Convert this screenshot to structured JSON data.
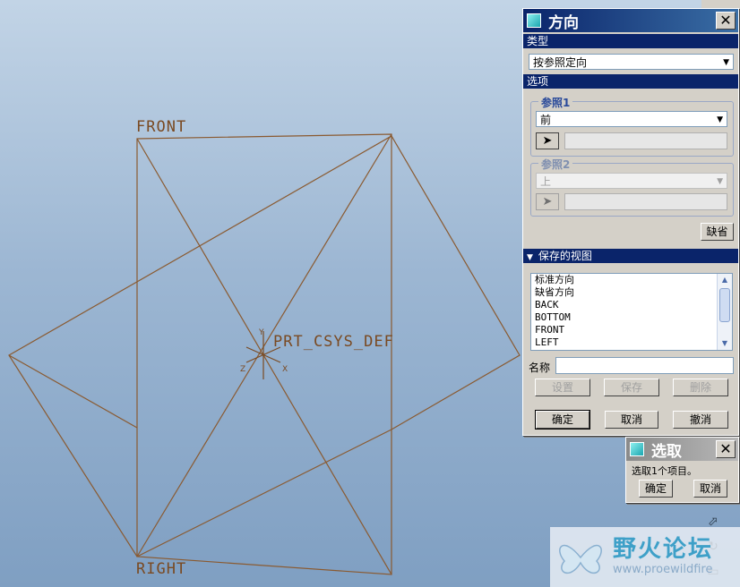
{
  "viewport": {
    "labels": {
      "front": "FRONT",
      "right": "RIGHT",
      "csys": "PRT_CSYS_DEF"
    },
    "colors": {
      "datum": "#8a5a30",
      "csys": "#7a4a22"
    }
  },
  "orient_dialog": {
    "title": "方向",
    "type_section": "类型",
    "type_value": "按参照定向",
    "options_section": "选项",
    "reference1": {
      "label": "参照1",
      "value": "前"
    },
    "reference2": {
      "label": "参照2",
      "value": "上"
    },
    "default_button": "缺省",
    "saved_views_section": "保存的视图",
    "saved_views": [
      "标准方向",
      "缺省方向",
      "BACK",
      "BOTTOM",
      "FRONT",
      "LEFT"
    ],
    "name_label": "名称",
    "name_value": "",
    "set_button": "设置",
    "save_button": "保存",
    "delete_button": "删除",
    "ok_button": "确定",
    "cancel_button": "取消",
    "undo_button": "撤消"
  },
  "select_dialog": {
    "title": "选取",
    "message": "选取1个项目。",
    "ok_button": "确定",
    "cancel_button": "取消"
  },
  "watermark": {
    "text": "野火论坛",
    "url": "www.proewildfire"
  },
  "icons": {
    "pick": "arrow-pointer-icon",
    "close": "close-icon",
    "collapse": "triangle-down-icon"
  }
}
